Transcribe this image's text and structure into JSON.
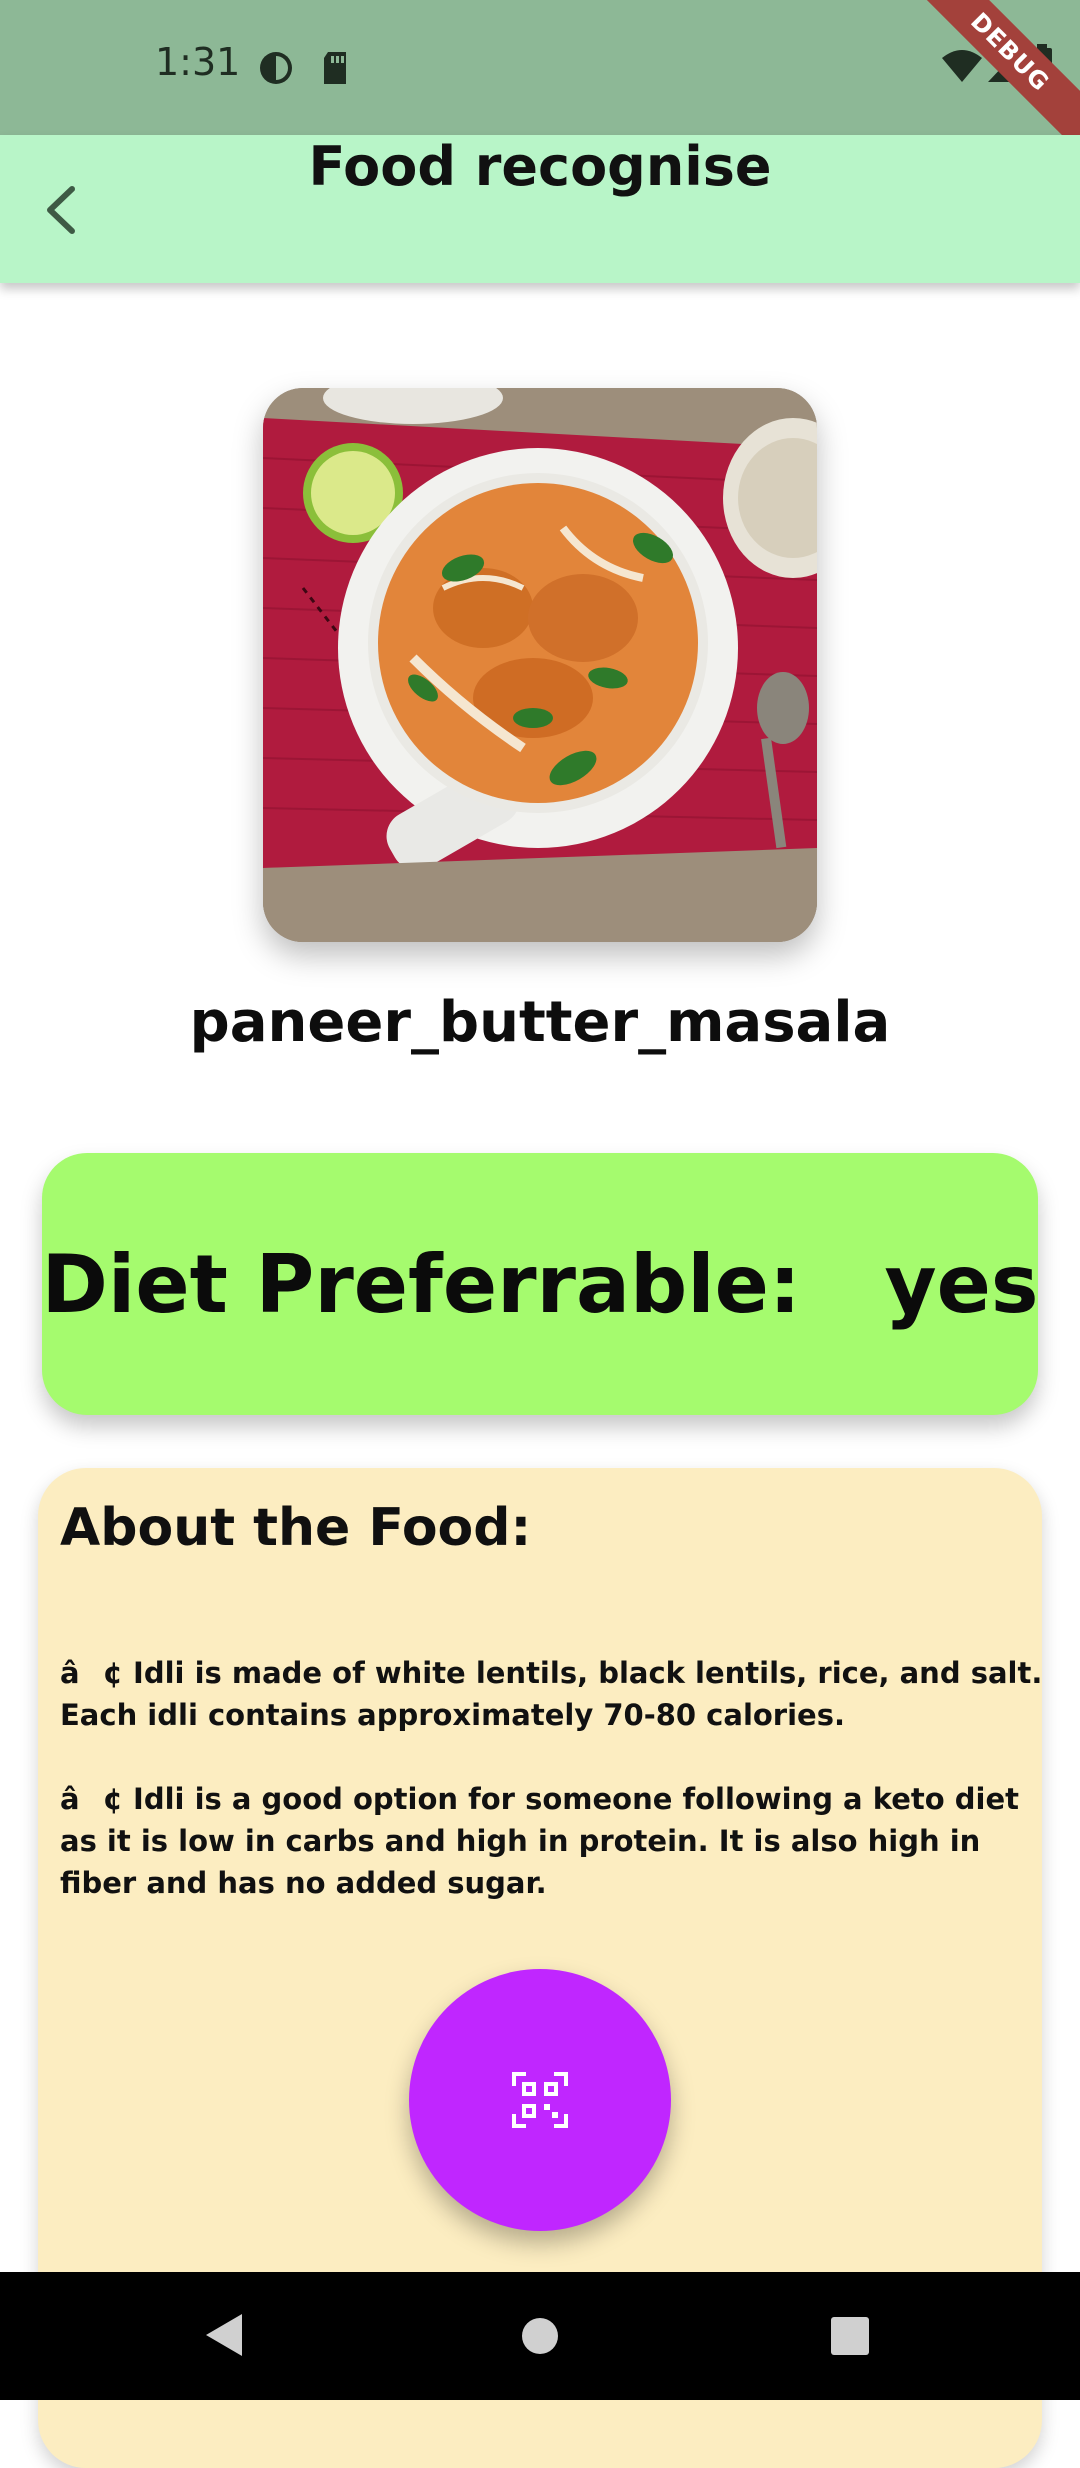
{
  "status_bar": {
    "time": "1:31",
    "icons": [
      "data-saver-icon",
      "sd-card-icon",
      "wifi-icon",
      "signal-icon",
      "battery-icon"
    ],
    "debug_label": "DEBUG"
  },
  "app_bar": {
    "title": "Food recognise",
    "back_icon": "chevron-left-icon",
    "background": "#b8f5c8"
  },
  "food": {
    "name": "paneer_butter_masala"
  },
  "diet": {
    "label": "Diet Preferrable:   yes",
    "background": "#a5fb6e"
  },
  "about": {
    "title": "About the Food:",
    "paragraphs": [
      "â¢ Idli is made of white lentils, black lentils, rice, and salt. Each idli contains approximately 70-80 calories.",
      "â¢ Idli is a good option for someone following a keto diet as it is low in carbs and high in protein. It is also high in fiber and has no added sugar."
    ],
    "background": "#fcedc1"
  },
  "scan_button": {
    "icon": "qr-scan-icon",
    "color": "#c026ff"
  },
  "nav_bar": {
    "icons": [
      "back-triangle-icon",
      "home-circle-icon",
      "recents-square-icon"
    ]
  }
}
